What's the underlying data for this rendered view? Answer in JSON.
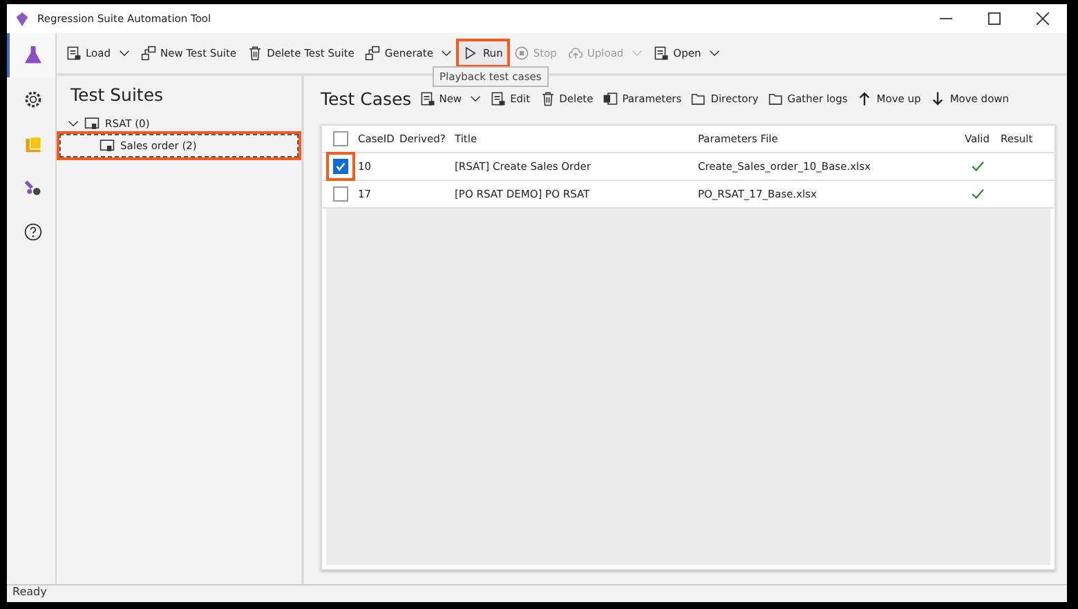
{
  "window": {
    "title": "Regression Suite Automation Tool"
  },
  "rail": [
    {
      "kind": "flask",
      "selected": true
    },
    {
      "kind": "gear",
      "selected": false
    },
    {
      "kind": "stack",
      "selected": false
    },
    {
      "kind": "tools",
      "selected": false
    },
    {
      "kind": "help",
      "selected": false
    }
  ],
  "toolbar": [
    {
      "kind": "load",
      "label": "Load",
      "dropdown": true,
      "disabled": false,
      "highlighted": false
    },
    {
      "kind": "new",
      "label": "New Test Suite",
      "dropdown": false,
      "disabled": false,
      "highlighted": false
    },
    {
      "kind": "delete",
      "label": "Delete Test Suite",
      "dropdown": false,
      "disabled": false,
      "highlighted": false
    },
    {
      "kind": "new",
      "label": "Generate",
      "dropdown": true,
      "disabled": false,
      "highlighted": false
    },
    {
      "kind": "run",
      "label": "Run",
      "dropdown": false,
      "disabled": false,
      "highlighted": true
    },
    {
      "kind": "stop",
      "label": "Stop",
      "dropdown": false,
      "disabled": true,
      "highlighted": false
    },
    {
      "kind": "upload",
      "label": "Upload",
      "dropdown": true,
      "disabled": true,
      "highlighted": false
    },
    {
      "kind": "open",
      "label": "Open",
      "dropdown": true,
      "disabled": false,
      "highlighted": false
    }
  ],
  "tooltip": "Playback test cases",
  "test_suites": {
    "title": "Test Suites",
    "tree": [
      {
        "label": "RSAT (0)",
        "expanded": true,
        "selected": false,
        "highlighted": false,
        "children": [
          {
            "label": "Sales order (2)",
            "selected": true,
            "highlighted": true
          }
        ]
      }
    ]
  },
  "test_cases": {
    "title": "Test Cases",
    "actions": [
      {
        "kind": "load",
        "label": "New",
        "dropdown": true
      },
      {
        "kind": "load",
        "label": "Edit",
        "dropdown": false
      },
      {
        "kind": "delete",
        "label": "Delete",
        "dropdown": false
      },
      {
        "kind": "params",
        "label": "Parameters",
        "dropdown": false
      },
      {
        "kind": "folder",
        "label": "Directory",
        "dropdown": false
      },
      {
        "kind": "folder",
        "label": "Gather logs",
        "dropdown": false
      },
      {
        "kind": "up",
        "label": "Move up",
        "dropdown": false
      },
      {
        "kind": "down",
        "label": "Move down",
        "dropdown": false
      }
    ],
    "columns": [
      "CaseID",
      "Derived?",
      "Title",
      "Parameters File",
      "Valid",
      "Result"
    ],
    "all_checked": false,
    "rows": [
      {
        "checked": true,
        "highlighted": true,
        "case_id": "10",
        "title": "[RSAT] Create Sales Order",
        "parameters_file": "Create_Sales_order_10_Base.xlsx",
        "valid": true
      },
      {
        "checked": false,
        "highlighted": false,
        "case_id": "17",
        "title": "[PO RSAT DEMO] PO RSAT",
        "parameters_file": "PO_RSAT_17_Base.xlsx",
        "valid": true
      }
    ]
  },
  "status_bar": "Ready"
}
